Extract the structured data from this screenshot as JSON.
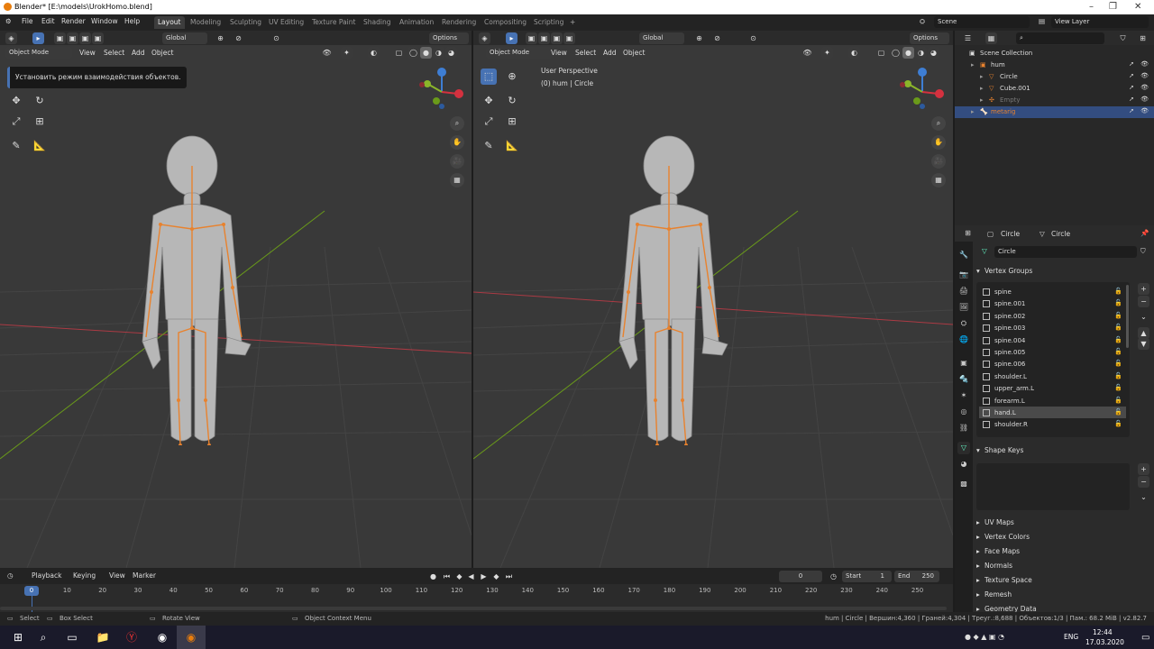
{
  "window": {
    "title": "Blender* [E:\\models\\UrokHomo.blend]"
  },
  "menu": [
    "File",
    "Edit",
    "Render",
    "Window",
    "Help"
  ],
  "workspaces": [
    "Layout",
    "Modeling",
    "Sculpting",
    "UV Editing",
    "Texture Paint",
    "Shading",
    "Animation",
    "Rendering",
    "Compositing",
    "Scripting",
    "+"
  ],
  "active_workspace": "Layout",
  "scene": {
    "name": "Scene",
    "view_layer": "View Layer"
  },
  "viewport_left": {
    "orientation": "Global",
    "options": "Options",
    "mode": "Object Mode",
    "menus": [
      "View",
      "Select",
      "Add",
      "Object"
    ],
    "tooltip": "Установить режим взаимодействия объектов."
  },
  "viewport_right": {
    "orientation": "Global",
    "options": "Options",
    "mode": "Object Mode",
    "menus": [
      "View",
      "Select",
      "Add",
      "Object"
    ],
    "perspective": "User Perspective",
    "context": "(0) hum | Circle"
  },
  "outliner": {
    "search_placeholder": "",
    "header": "Scene Collection",
    "rows": [
      {
        "label": "hum",
        "indent": 1,
        "selected": false,
        "dim": false
      },
      {
        "label": "Circle",
        "indent": 2,
        "selected": false,
        "dim": false
      },
      {
        "label": "Cube.001",
        "indent": 2,
        "selected": false,
        "dim": false
      },
      {
        "label": "Empty",
        "indent": 2,
        "selected": false,
        "dim": true
      },
      {
        "label": "metarig",
        "indent": 1,
        "selected": true,
        "dim": false
      }
    ]
  },
  "properties": {
    "object": "Circle",
    "data": "Circle",
    "mesh_name": "Circle",
    "vertex_groups_label": "Vertex Groups",
    "vertex_groups": [
      "spine",
      "spine.001",
      "spine.002",
      "spine.003",
      "spine.004",
      "spine.005",
      "spine.006",
      "shoulder.L",
      "upper_arm.L",
      "forearm.L",
      "hand.L",
      "shoulder.R"
    ],
    "selected_group": "hand.L",
    "shape_keys_label": "Shape Keys",
    "panels": [
      "UV Maps",
      "Vertex Colors",
      "Face Maps",
      "Normals",
      "Texture Space",
      "Remesh",
      "Geometry Data"
    ]
  },
  "timeline": {
    "menus": [
      "Playback",
      "Keying",
      "View",
      "Marker"
    ],
    "current_frame": "0",
    "start_label": "Start",
    "start": "1",
    "end_label": "End",
    "end": "250",
    "ticks": [
      "0",
      "10",
      "20",
      "30",
      "40",
      "50",
      "60",
      "70",
      "80",
      "90",
      "100",
      "110",
      "120",
      "130",
      "140",
      "150",
      "160",
      "170",
      "180",
      "190",
      "200",
      "210",
      "220",
      "230",
      "240",
      "250"
    ]
  },
  "status": {
    "select": "Select",
    "box_select": "Box Select",
    "rotate_view": "Rotate View",
    "context_menu": "Object Context Menu",
    "stats": "hum | Circle | Вершин:4,360 | Граней:4,304 | Треуг.:8,688 | Объектов:1/3 | Пам.: 68.2 MiB | v2.82.7"
  },
  "taskbar": {
    "lang": "ENG",
    "time": "12:44",
    "date": "17.03.2020"
  },
  "colors": {
    "accent": "#4772b3",
    "selected_row": "#334d80",
    "bone": "#e8822e",
    "viewport": "#393939",
    "x_axis": "#ab3a44",
    "y_axis": "#6a9a1a"
  }
}
